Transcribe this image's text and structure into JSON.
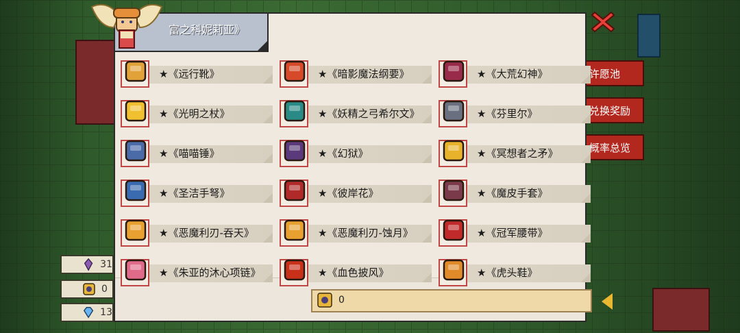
{
  "header": {
    "title": "富之科妮莉亚》"
  },
  "side_buttons": [
    "许愿池",
    "兑换奖励",
    "概率总览"
  ],
  "side_buttons_visible": [
    "许愿池",
    "兑换奖励",
    "概率总览"
  ],
  "resources": [
    {
      "icon": "purple-crystal-icon",
      "value": "31"
    },
    {
      "icon": "token-icon",
      "value": "0"
    },
    {
      "icon": "gem-icon",
      "value": "13"
    }
  ],
  "items": [
    {
      "name": "★《远行靴》",
      "icon": "boots-icon"
    },
    {
      "name": "★《暗影魔法纲要》",
      "icon": "spellbook-icon"
    },
    {
      "name": "★《大荒幻神》",
      "icon": "mask-icon"
    },
    {
      "name": "★《光明之杖》",
      "icon": "staff-icon"
    },
    {
      "name": "★《妖精之弓希尔文》",
      "icon": "bow-icon"
    },
    {
      "name": "★《芬里尔》",
      "icon": "wolf-gauntlet-icon"
    },
    {
      "name": "★《喵喵锤》",
      "icon": "hammer-icon"
    },
    {
      "name": "★《幻狱》",
      "icon": "axe-icon"
    },
    {
      "name": "★《冥想者之矛》",
      "icon": "spear-icon"
    },
    {
      "name": "★《圣洁手弩》",
      "icon": "crossbow-icon"
    },
    {
      "name": "★《彼岸花》",
      "icon": "sword-icon"
    },
    {
      "name": "★《魔皮手套》",
      "icon": "glove-icon"
    },
    {
      "name": "★《恶魔利刃-吞天》",
      "icon": "demon-blade-icon"
    },
    {
      "name": "★《恶魔利刃-蚀月》",
      "icon": "demon-blade-icon"
    },
    {
      "name": "★《冠军腰带》",
      "icon": "belt-icon"
    },
    {
      "name": "★《朱亚的沐心项链》",
      "icon": "necklace-icon"
    },
    {
      "name": "★《血色披风》",
      "icon": "cloak-icon"
    },
    {
      "name": "★《虎头鞋》",
      "icon": "tiger-shoes-icon"
    }
  ],
  "counter": {
    "value": "0",
    "icon": "token-icon"
  },
  "colors": {
    "panel": "#efe9df",
    "red_button": "#b2281f",
    "frame_border": "#c04646"
  }
}
